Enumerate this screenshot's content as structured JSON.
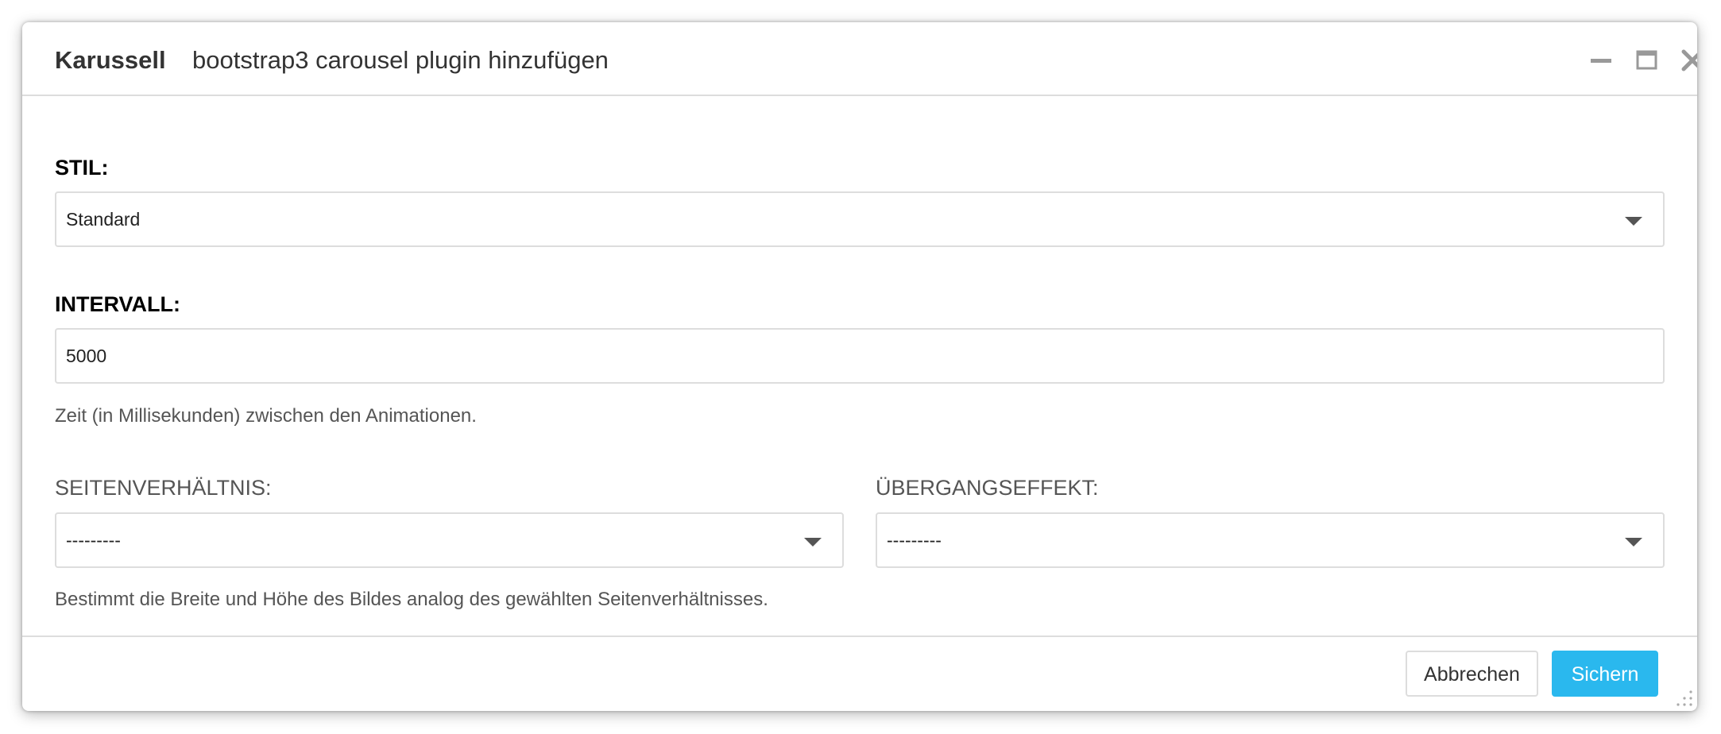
{
  "dialog": {
    "title": "Karussell",
    "subtitle": "bootstrap3 carousel plugin hinzufügen",
    "controls": {
      "minimize_icon": "minimize-icon",
      "maximize_icon": "maximize-icon",
      "close_icon": "close-icon"
    }
  },
  "form": {
    "style": {
      "label": "STIL:",
      "value": "Standard"
    },
    "interval": {
      "label": "INTERVALL:",
      "value": "5000",
      "help": "Zeit (in Millisekunden) zwischen den Animationen."
    },
    "aspect_ratio": {
      "label": "SEITENVERHÄLTNIS:",
      "value": "---------",
      "help": "Bestimmt die Breite und Höhe des Bildes analog des gewählten Seitenverhältnisses."
    },
    "transition": {
      "label": "ÜBERGANGSEFFEKT:",
      "value": "---------"
    }
  },
  "footer": {
    "cancel_label": "Abbrechen",
    "save_label": "Sichern"
  },
  "colors": {
    "primary_button": "#2ab8ee",
    "border": "#dddddd",
    "text": "#333333"
  }
}
